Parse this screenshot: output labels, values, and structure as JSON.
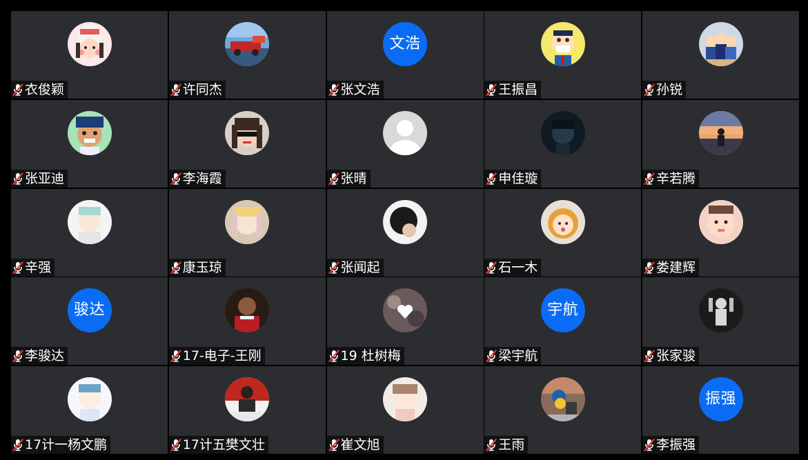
{
  "colors": {
    "background": "#000000",
    "tile": "#2b2d30",
    "text_avatar_bg": "#0a6cf5",
    "mute_red": "#e5392f",
    "name_text": "#ffffff"
  },
  "participants": [
    {
      "name": "衣俊颖",
      "avatar": "photo",
      "avatar_icon": "cartoon-girl-avatar",
      "muted": true
    },
    {
      "name": "许同杰",
      "avatar": "photo",
      "avatar_icon": "red-car-sky-avatar",
      "muted": true
    },
    {
      "name": "张文浩",
      "avatar": "text",
      "avatar_text": "文浩",
      "muted": true
    },
    {
      "name": "王振昌",
      "avatar": "photo",
      "avatar_icon": "anime-man-mask-avatar",
      "muted": true
    },
    {
      "name": "孙锐",
      "avatar": "photo",
      "avatar_icon": "cartoon-group-avatar",
      "muted": true
    },
    {
      "name": "张亚迪",
      "avatar": "photo",
      "avatar_icon": "anime-boy-smile-avatar",
      "muted": true
    },
    {
      "name": "李海霞",
      "avatar": "photo",
      "avatar_icon": "girl-sunglasses-avatar",
      "muted": true
    },
    {
      "name": "张晴",
      "avatar": "photo",
      "avatar_icon": "default-person-avatar",
      "muted": true
    },
    {
      "name": "申佳璇",
      "avatar": "photo",
      "avatar_icon": "dark-portrait-avatar",
      "muted": true
    },
    {
      "name": "辛若腾",
      "avatar": "photo",
      "avatar_icon": "sunset-silhouette-avatar",
      "muted": true
    },
    {
      "name": "辛强",
      "avatar": "photo",
      "avatar_icon": "anime-boy-white-avatar",
      "muted": true
    },
    {
      "name": "康玉琼",
      "avatar": "photo",
      "avatar_icon": "anime-girl-pastel-avatar",
      "muted": true
    },
    {
      "name": "张闻起",
      "avatar": "photo",
      "avatar_icon": "spiky-hair-avatar",
      "muted": true
    },
    {
      "name": "石一木",
      "avatar": "photo",
      "avatar_icon": "baby-hood-avatar",
      "muted": true
    },
    {
      "name": "娄建辉",
      "avatar": "photo",
      "avatar_icon": "baby-face-avatar",
      "muted": true
    },
    {
      "name": "李骏达",
      "avatar": "text",
      "avatar_text": "骏达",
      "muted": true
    },
    {
      "name": "17-电子-王刚",
      "avatar": "photo",
      "avatar_icon": "boy-red-shirt-avatar",
      "muted": true
    },
    {
      "name": "19 杜树梅",
      "avatar": "photo",
      "avatar_icon": "heart-clouds-avatar",
      "muted": true
    },
    {
      "name": "梁宇航",
      "avatar": "text",
      "avatar_text": "宇航",
      "muted": true
    },
    {
      "name": "张家骏",
      "avatar": "photo",
      "avatar_icon": "basketball-player-avatar",
      "muted": true
    },
    {
      "name": "17计一杨文鹏",
      "avatar": "photo",
      "avatar_icon": "anime-boy-light-avatar",
      "muted": true
    },
    {
      "name": "17计五樊文壮",
      "avatar": "photo",
      "avatar_icon": "man-red-backdrop-avatar",
      "muted": true
    },
    {
      "name": "崔文旭",
      "avatar": "photo",
      "avatar_icon": "anime-girl-pink-avatar",
      "muted": true
    },
    {
      "name": "王雨",
      "avatar": "photo",
      "avatar_icon": "duck-toy-avatar",
      "muted": true
    },
    {
      "name": "李振强",
      "avatar": "text",
      "avatar_text": "振强",
      "muted": true
    }
  ]
}
